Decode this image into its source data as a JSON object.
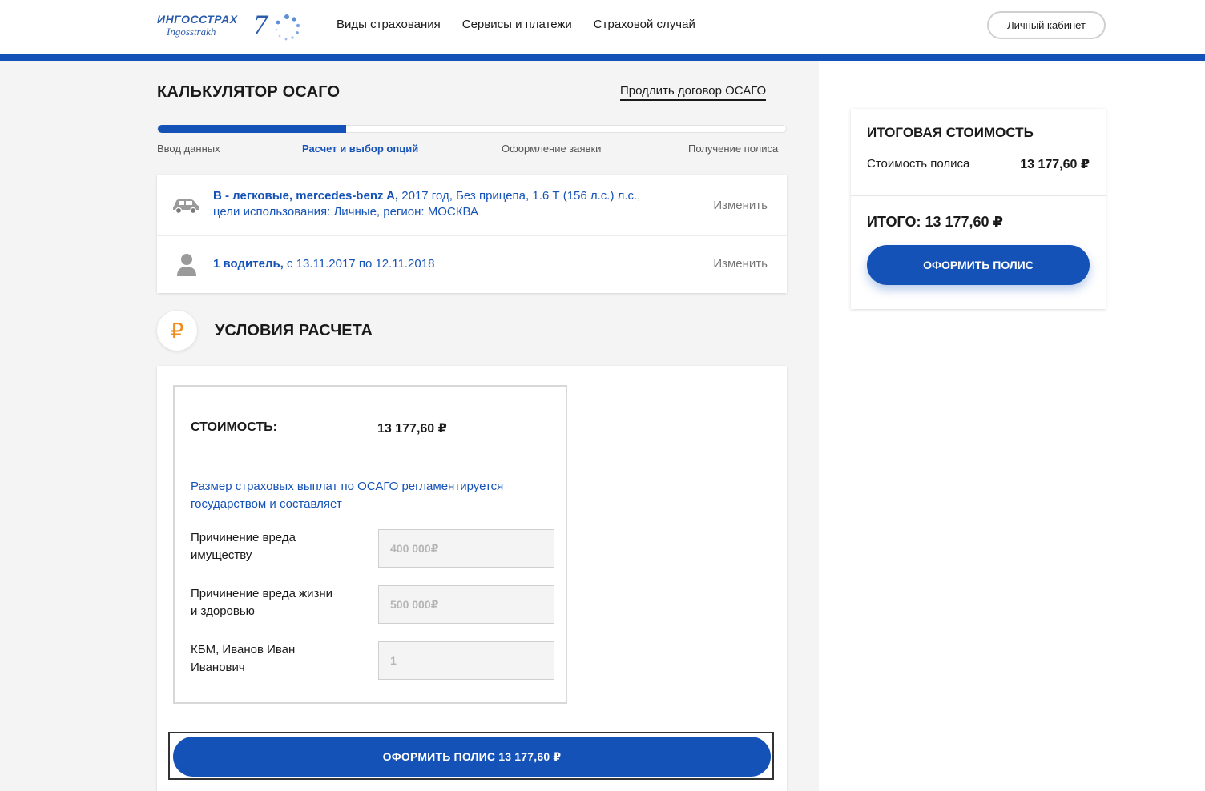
{
  "header": {
    "logo_ru": "ИНГОССТРАХ",
    "logo_en": "Ingosstrakh",
    "logo_num": "7",
    "nav": [
      "Виды страхования",
      "Сервисы и платежи",
      "Страховой случай"
    ],
    "cabinet_label": "Личный кабинет",
    "accent_color": "#1552b8"
  },
  "page": {
    "title": "КАЛЬКУЛЯТОР ОСАГО",
    "renew_link": "Продлить договор ОСАГО",
    "progress_fraction": 0.3,
    "steps": [
      "Ввод данных",
      "Расчет и выбор опций",
      "Оформление заявки",
      "Получение полиса"
    ],
    "active_step_index": 1
  },
  "summary": {
    "vehicle_bold": "B - легковые, mercedes-benz A,",
    "vehicle_rest": " 2017 год, Без прицепа, 1.6 Т (156 л.с.) л.с.,",
    "vehicle_line2": "цели использования: Личные, регион: МОСКВА",
    "drivers_bold": "1 водитель,",
    "drivers_rest": " с 13.11.2017 по 12.11.2018",
    "change_label": "Изменить",
    "icons": [
      "car-icon",
      "person-icon"
    ]
  },
  "conditions": {
    "icon_glyph": "₽",
    "title": "УСЛОВИЯ РАСЧЕТА",
    "cost_label": "СТОИМОСТЬ:",
    "cost_value": "13 177,60 ₽",
    "note": "Размер страховых выплат по ОСАГО регламентируется государством и составляет",
    "fields": [
      {
        "label": "Причинение вреда имуществу",
        "value": "400 000₽"
      },
      {
        "label": "Причинение вреда жизни и здоровью",
        "value": "500 000₽"
      },
      {
        "label": "КБМ, Иванов Иван Иванович",
        "value": "1"
      }
    ],
    "submit_label": "ОФОРМИТЬ ПОЛИС 13 177,60 ₽"
  },
  "total": {
    "title": "ИТОГОВАЯ СТОИМОСТЬ",
    "policy_label": "Стоимость полиса",
    "policy_value": "13 177,60 ₽",
    "grand_total": "ИТОГО: 13 177,60 ₽",
    "button_label": "ОФОРМИТЬ ПОЛИС"
  }
}
